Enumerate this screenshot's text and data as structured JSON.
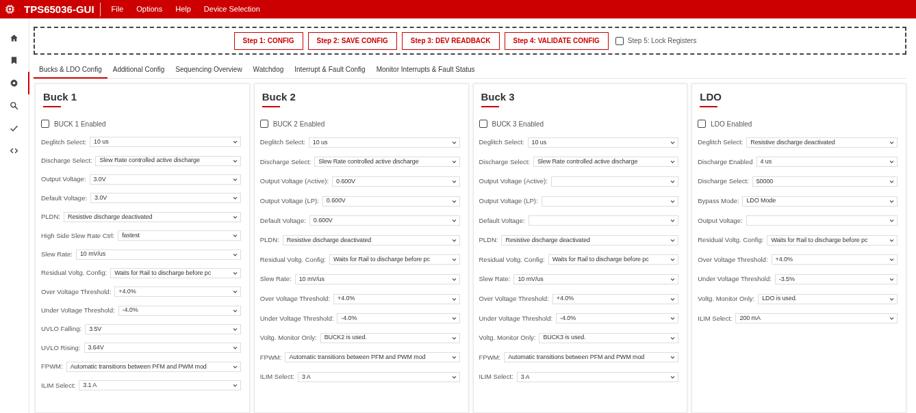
{
  "header": {
    "title": "TPS65036-GUI",
    "menu": [
      "File",
      "Options",
      "Help",
      "Device Selection"
    ]
  },
  "sidebar": {
    "items": [
      {
        "kind": "home",
        "selected": false
      },
      {
        "kind": "bookmark",
        "selected": false
      },
      {
        "kind": "gear",
        "selected": true
      },
      {
        "kind": "search",
        "selected": false
      },
      {
        "kind": "check",
        "selected": false
      },
      {
        "kind": "code",
        "selected": false
      }
    ]
  },
  "steps": {
    "buttons": [
      "Step 1: CONFIG",
      "Step 2: SAVE CONFIG",
      "Step 3: DEV READBACK",
      "Step 4: VALIDATE CONFIG"
    ],
    "lock": {
      "label": "Step 5: Lock Registers",
      "checked": false
    }
  },
  "tabs": [
    {
      "label": "Bucks & LDO Config",
      "selected": true
    },
    {
      "label": "Additional Config",
      "selected": false
    },
    {
      "label": "Sequencing Overview",
      "selected": false
    },
    {
      "label": "Watchdog",
      "selected": false
    },
    {
      "label": "Interrupt & Fault Config",
      "selected": false
    },
    {
      "label": "Monitor Interrupts & Fault Status",
      "selected": false
    }
  ],
  "panels": [
    {
      "title": "Buck 1",
      "enabled": {
        "label": "BUCK 1 Enabled",
        "checked": false
      },
      "fields": [
        {
          "label": "Deglitch Select:",
          "value": "10 us"
        },
        {
          "label": "Discharge Select:",
          "value": "Slew Rate controlled active discharge"
        },
        {
          "label": "Output Voltage:",
          "value": "3.0V"
        },
        {
          "label": "Default Voltage:",
          "value": "3.0V"
        },
        {
          "label": "PLDN:",
          "value": "Resistive discharge deactivated"
        },
        {
          "label": "High Side Slew Rate Ctrl:",
          "value": "fastest"
        },
        {
          "label": "Slew Rate:",
          "value": "10 mV/us"
        },
        {
          "label": "Residual Voltg. Config:",
          "value": "Waits for Rail to discharge before pc"
        },
        {
          "label": "Over Voltage Threshold:",
          "value": "+4.0%"
        },
        {
          "label": "Under Voltage Threshold:",
          "value": "-4.0%"
        },
        {
          "label": "UVLO Falling:",
          "value": "3.5V"
        },
        {
          "label": "UVLO Rising:",
          "value": "3.64V"
        },
        {
          "label": "FPWM:",
          "value": "Automatic transitions between PFM and PWM mod"
        },
        {
          "label": "ILIM Select:",
          "value": "3.1 A"
        }
      ]
    },
    {
      "title": "Buck 2",
      "enabled": {
        "label": "BUCK 2 Enabled",
        "checked": false
      },
      "fields": [
        {
          "label": "Deglitch Select:",
          "value": "10 us"
        },
        {
          "label": "Discharge Select:",
          "value": "Slew Rate controlled active discharge"
        },
        {
          "label": "Output Voltage (Active):",
          "value": "0.600V"
        },
        {
          "label": "Output Voltage (LP):",
          "value": "0.600V"
        },
        {
          "label": "Default Voltage:",
          "value": "0.600V"
        },
        {
          "label": "PLDN:",
          "value": "Resistive discharge deactivated"
        },
        {
          "label": "Residual Voltg. Config:",
          "value": "Waits for Rail to discharge before pc"
        },
        {
          "label": "Slew Rate:",
          "value": "10 mV/us"
        },
        {
          "label": "Over Voltage Threshold:",
          "value": "+4.0%"
        },
        {
          "label": "Under Voltage Threshold:",
          "value": "-4.0%"
        },
        {
          "label": "Voltg. Monitor Only:",
          "value": "BUCK2 is used."
        },
        {
          "label": "FPWM:",
          "value": "Automatic transitions between PFM and PWM mod"
        },
        {
          "label": "ILIM Select:",
          "value": "3 A"
        }
      ]
    },
    {
      "title": "Buck 3",
      "enabled": {
        "label": "BUCK 3 Enabled",
        "checked": false
      },
      "fields": [
        {
          "label": "Deglitch Select:",
          "value": "10 us"
        },
        {
          "label": "Discharge Select:",
          "value": "Slew Rate controlled active discharge"
        },
        {
          "label": "Output Voltage (Active):"
        },
        {
          "label": "Output Voltage (LP):"
        },
        {
          "label": "Default Voltage:"
        },
        {
          "label": "PLDN:",
          "value": "Resistive discharge deactivated"
        },
        {
          "label": "Residual Voltg. Config:",
          "value": "Waits for Rail to discharge before pc"
        },
        {
          "label": "Slew Rate:",
          "value": "10 mV/us"
        },
        {
          "label": "Over Voltage Threshold:",
          "value": "+4.0%"
        },
        {
          "label": "Under Voltage Threshold:",
          "value": "-4.0%"
        },
        {
          "label": "Voltg. Monitor Only:",
          "value": "BUCK3 is used."
        },
        {
          "label": "FPWM:",
          "value": "Automatic transitions between PFM and PWM mod"
        },
        {
          "label": "ILIM Select:",
          "value": "3 A"
        }
      ]
    },
    {
      "title": "LDO",
      "enabled": {
        "label": "LDO Enabled",
        "checked": false
      },
      "fields": [
        {
          "label": "Deglitch Select:",
          "value": "Resistive discharge deactivated"
        },
        {
          "label": "Discharge Enabled",
          "value": "4 us"
        },
        {
          "label": "Discharge Select:",
          "value": "50000"
        },
        {
          "label": "Bypass Mode:",
          "value": "LDO Mode"
        },
        {
          "label": "Output Voltage:"
        },
        {
          "label": "Residual Voltg. Config:",
          "value": "Waits for Rail to discharge before pc"
        },
        {
          "label": "Over Voltage Threshold:",
          "value": "+4.0%"
        },
        {
          "label": "Under Voltage Threshold:",
          "value": "-3.5%"
        },
        {
          "label": "Voltg. Monitor Only:",
          "value": "LDO is used."
        },
        {
          "label": "ILIM Select:",
          "value": "200 mA"
        }
      ]
    }
  ]
}
